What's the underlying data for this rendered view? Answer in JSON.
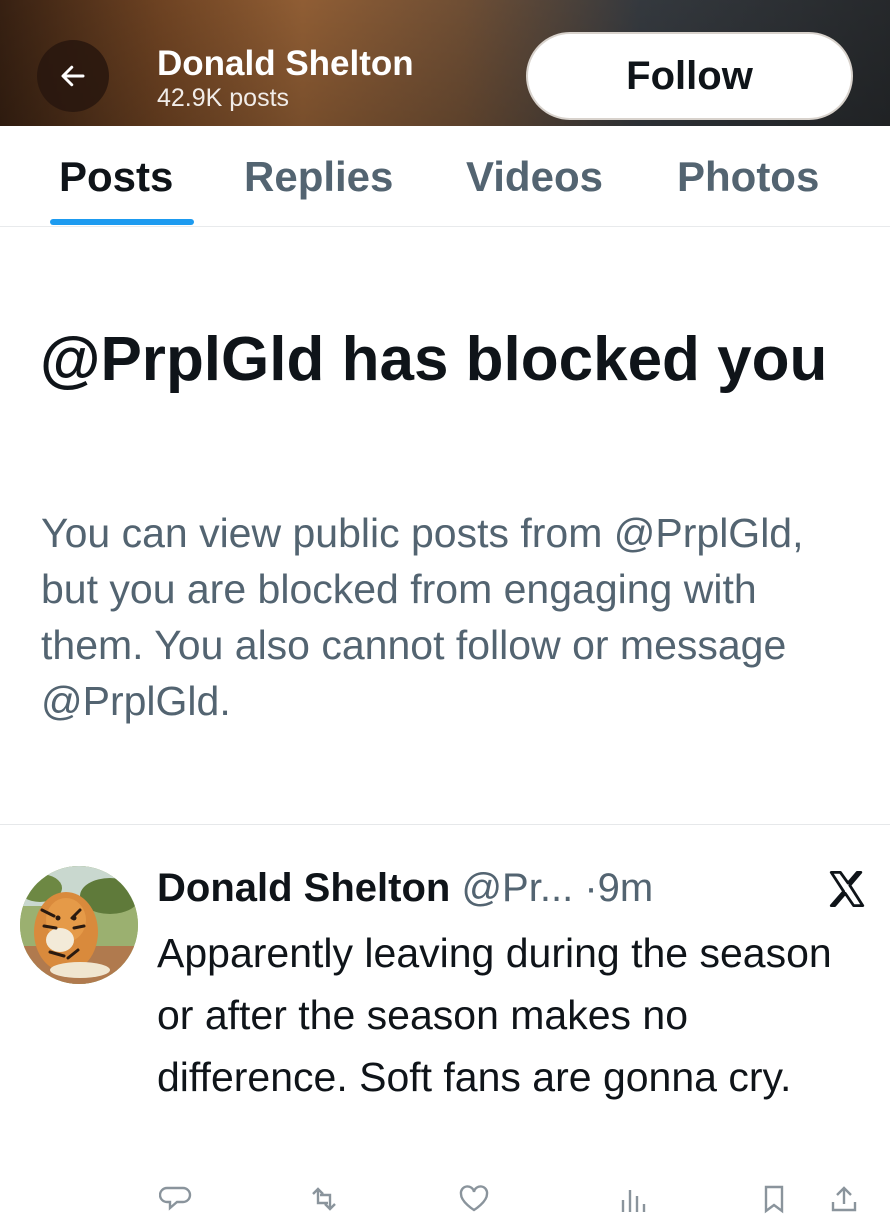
{
  "header": {
    "name": "Donald Shelton",
    "post_count": "42.9K posts",
    "follow_label": "Follow"
  },
  "tabs": [
    {
      "label": "Posts",
      "active": true
    },
    {
      "label": "Replies",
      "active": false
    },
    {
      "label": "Videos",
      "active": false
    },
    {
      "label": "Photos",
      "active": false
    }
  ],
  "blocked": {
    "title": "@PrplGld has blocked you",
    "description": "You can view public posts from @PrplGld, but you are blocked from engaging with them. You also cannot follow or message @PrplGld."
  },
  "post": {
    "author": "Donald Shelton",
    "handle": "@Pr...",
    "separator": "·",
    "time": "9m",
    "text": "Apparently leaving during the season or after the season makes no difference. Soft fans are gonna cry.",
    "platform_icon": "x-logo-icon",
    "actions": [
      "reply-icon",
      "repost-icon",
      "like-icon",
      "views-icon",
      "bookmark-icon",
      "share-icon"
    ]
  },
  "colors": {
    "accent": "#1d9bf0",
    "text_primary": "#0f1419",
    "text_secondary": "#536471"
  }
}
